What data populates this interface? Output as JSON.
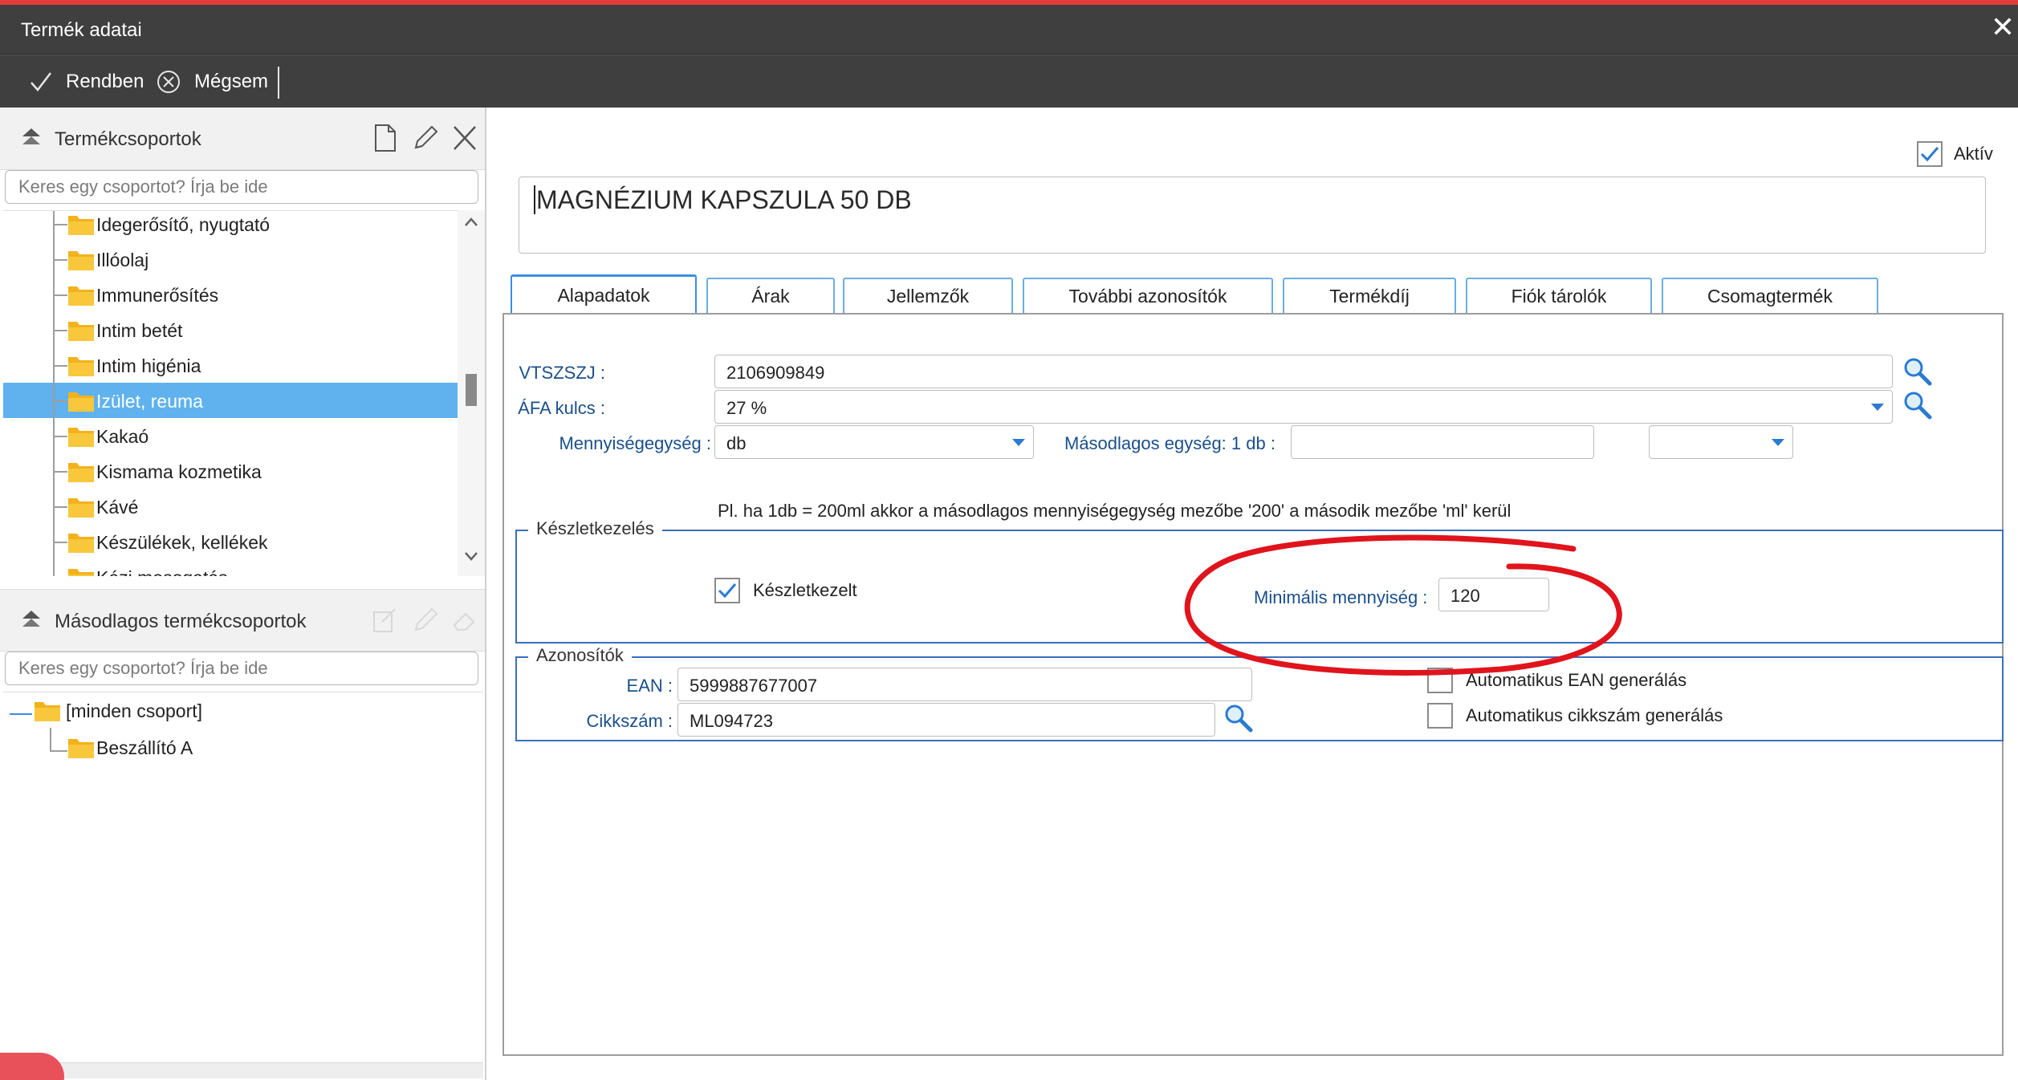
{
  "window": {
    "title": "Termék adatai",
    "close_glyph": "✕"
  },
  "toolbar": {
    "ok_label": "Rendben",
    "cancel_label": "Mégsem"
  },
  "groups_panel": {
    "title": "Termékcsoportok",
    "search_placeholder": "Keres egy csoportot? Írja be ide",
    "items": [
      {
        "label": "Idegerősítő, nyugtató"
      },
      {
        "label": "Illóolaj"
      },
      {
        "label": "Immunerősítés"
      },
      {
        "label": "Intim betét"
      },
      {
        "label": "Intim higénia"
      },
      {
        "label": "Izület, reuma",
        "selected": true
      },
      {
        "label": "Kakaó"
      },
      {
        "label": "Kismama kozmetika"
      },
      {
        "label": "Kávé"
      },
      {
        "label": "Készülékek, kellékek"
      },
      {
        "label": "Kézi mosogatás"
      }
    ]
  },
  "secondary_panel": {
    "title": "Másodlagos termékcsoportok",
    "search_placeholder": "Keres egy csoportot? Írja be ide",
    "root": "[minden csoport]",
    "child": "Beszállító A"
  },
  "product": {
    "active_label": "Aktív",
    "active": true,
    "name": "MAGNÉZIUM KAPSZULA 50 DB"
  },
  "tabs": [
    {
      "label": "Alapadatok",
      "active": true
    },
    {
      "label": "Árak"
    },
    {
      "label": "Jellemzők"
    },
    {
      "label": "További azonosítók"
    },
    {
      "label": "Termékdíj"
    },
    {
      "label": "Fiók tárolók"
    },
    {
      "label": "Csomagtermék"
    }
  ],
  "basic": {
    "vtszszj_label": "VTSZSZJ :",
    "vtszszj_value": "2106909849",
    "afa_label": "ÁFA kulcs :",
    "afa_value": "27 %",
    "unit_label": "Mennyiségegység :",
    "unit_value": "db",
    "secondary_unit_label": "Másodlagos egység: 1 db :",
    "secondary_unit_value": "",
    "secondary_unit_select": "",
    "hint": "Pl. ha 1db = 200ml akkor a másodlagos mennyiségegység mezőbe '200' a második mezőbe 'ml' kerül"
  },
  "stock": {
    "legend": "Készletkezelés",
    "managed_label": "Készletkezelt",
    "managed": true,
    "min_label": "Minimális mennyiség :",
    "min_value": "120"
  },
  "ids": {
    "legend": "Azonosítók",
    "ean_label": "EAN :",
    "ean_value": "5999887677007",
    "sku_label": "Cikkszám :",
    "sku_value": "ML094723",
    "auto_ean_label": "Automatikus EAN generálás",
    "auto_sku_label": "Automatikus cikkszám generálás"
  },
  "colors": {
    "titlebar": "#3f3f3f",
    "selection": "#5fb2ee",
    "accent": "#3b8de0",
    "label_blue": "#1a4f8a",
    "annotation": "#e0141c"
  }
}
